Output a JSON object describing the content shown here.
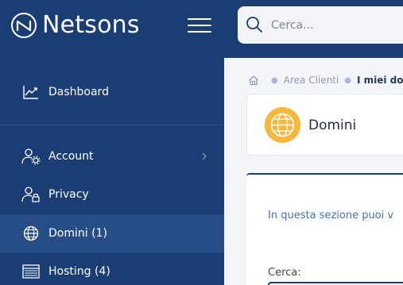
{
  "header": {
    "logo_text": "Netsons",
    "search_placeholder": "Cerca..."
  },
  "sidebar": {
    "items": [
      {
        "label": "Dashboard",
        "icon": "chart-line-icon"
      },
      {
        "label": "Account",
        "icon": "user-gear-icon",
        "has_submenu": true
      },
      {
        "label": "Privacy",
        "icon": "user-lock-icon"
      },
      {
        "label": "Domini (1)",
        "icon": "globe-icon",
        "active": true
      },
      {
        "label": "Hosting (4)",
        "icon": "server-icon"
      }
    ]
  },
  "breadcrumb": {
    "link": "Area Clienti",
    "current": "I miei domi"
  },
  "page": {
    "title": "Domini",
    "intro": "In questa sezione puoi v",
    "search_label": "Cerca:"
  },
  "colors": {
    "brand": "#1a3d73",
    "active_item": "#264d86",
    "accent": "#f6b73c",
    "link": "#3f74c6"
  }
}
